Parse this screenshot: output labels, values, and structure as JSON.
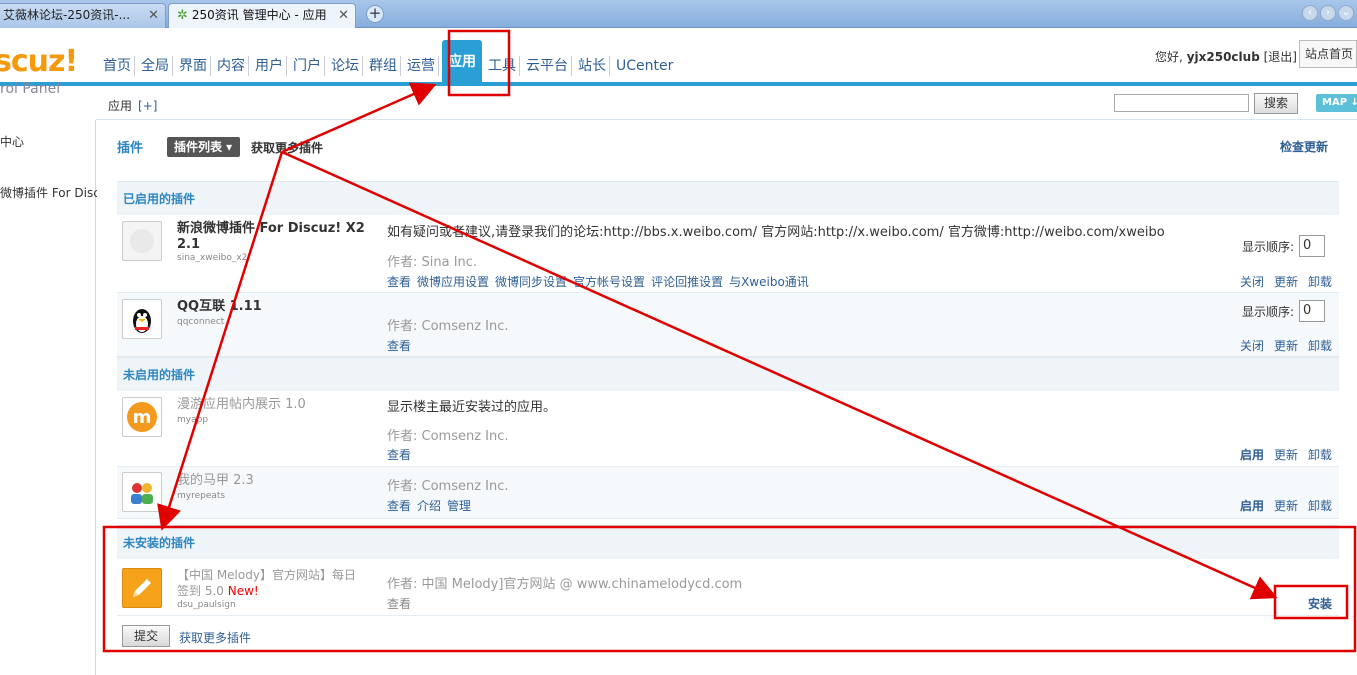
{
  "browser": {
    "tabs": [
      {
        "label": "艾薇林论坛-250资讯-...",
        "active": false
      },
      {
        "label": "250资讯 管理中心 - 应用",
        "active": true
      }
    ],
    "new_tab": "+",
    "back_arrow": "‹",
    "forward_arrow": "›",
    "menu_arrow": "⌄"
  },
  "header": {
    "logo": "scuz!",
    "logo_sub": "rol Panel",
    "nav": [
      "首页",
      "全局",
      "界面",
      "内容",
      "用户",
      "门户",
      "论坛",
      "群组",
      "运营",
      "应用",
      "工具",
      "云平台",
      "站长",
      "UCenter"
    ],
    "active_nav": "应用",
    "greeting": "您好,",
    "username": "yjx250club",
    "logout": "[退出]",
    "site_home": "站点首页"
  },
  "subbar": {
    "crumb": "应用",
    "add": "[+]",
    "search_button": "搜索",
    "map_button": "MAP ↓"
  },
  "sidebar": {
    "items": [
      "中心",
      "微博插件 For Discu"
    ]
  },
  "main": {
    "title": "插件",
    "plugin_list_button": "插件列表 ▾",
    "get_more": "获取更多插件",
    "check_update": "检查更新",
    "enabled_header": "已启用的插件",
    "disabled_header": "未启用的插件",
    "uninstalled_header": "未安装的插件",
    "order_label": "显示顺序:",
    "enabled": [
      {
        "name": "新浪微博插件 For Discuz! X2 2.1",
        "id": "sina_xweibo_x2",
        "desc": "如有疑问或者建议,请登录我们的论坛:http://bbs.x.weibo.com/ 官方网站:http://x.weibo.com/ 官方微博:http://weibo.com/xweibo",
        "author": "作者: Sina Inc.",
        "links": [
          "查看",
          "微博应用设置",
          "微博同步设置",
          "官方帐号设置",
          "评论回推设置",
          "与Xweibo通讯"
        ],
        "order": "0",
        "ops": [
          "关闭",
          "更新",
          "卸载"
        ]
      },
      {
        "name": "QQ互联 1.11",
        "id": "qqconnect",
        "desc": "",
        "author": "作者: Comsenz Inc.",
        "links": [
          "查看"
        ],
        "order": "0",
        "ops": [
          "关闭",
          "更新",
          "卸载"
        ]
      }
    ],
    "disabled": [
      {
        "name": "漫游应用帖内展示 1.0",
        "id": "myapp",
        "desc": "显示楼主最近安装过的应用。",
        "author": "作者: Comsenz Inc.",
        "links": [
          "查看"
        ],
        "ops": [
          "启用",
          "更新",
          "卸载"
        ]
      },
      {
        "name": "我的马甲 2.3",
        "id": "myrepeats",
        "desc": "",
        "author": "作者: Comsenz Inc.",
        "links": [
          "查看",
          "介绍",
          "管理"
        ],
        "ops": [
          "启用",
          "更新",
          "卸载"
        ]
      }
    ],
    "uninstalled": [
      {
        "name": "【中国 Melody】官方网站】每日签到 5.0",
        "new_badge": "New!",
        "id": "dsu_paulsign",
        "author": "作者: 中国 Melody]官方网站 @ www.chinamelodycd.com",
        "links": [
          "查看"
        ],
        "install": "安装"
      }
    ],
    "submit_button": "提交",
    "get_more_bottom": "获取更多插件"
  },
  "annotation_color": "#e00000"
}
